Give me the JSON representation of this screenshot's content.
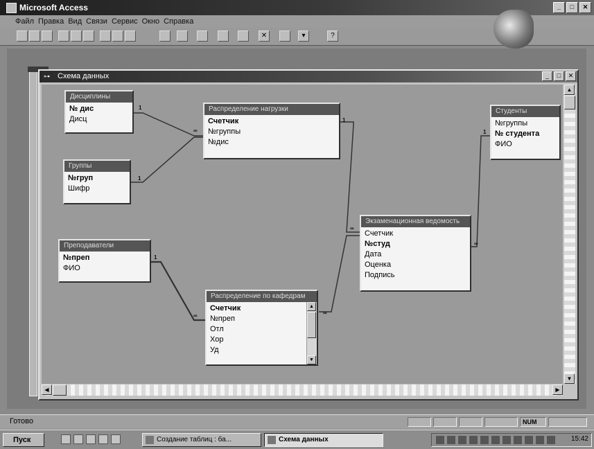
{
  "app": {
    "title": "Microsoft Access"
  },
  "menu": [
    "Файл",
    "Правка",
    "Вид",
    "Связи",
    "Сервис",
    "Окно",
    "Справка"
  ],
  "schema_window": {
    "title": "Схема данных"
  },
  "tables": [
    {
      "title": "Дисциплины",
      "fields": [
        {
          "name": "№ дис",
          "key": true
        },
        {
          "name": "Дисц",
          "key": false
        }
      ]
    },
    {
      "title": "Распределение нагрузки",
      "fields": [
        {
          "name": "Счетчик",
          "key": true
        },
        {
          "name": "№группы",
          "key": false
        },
        {
          "name": "№дис",
          "key": false
        }
      ]
    },
    {
      "title": "Студенты",
      "fields": [
        {
          "name": "№группы",
          "key": false
        },
        {
          "name": "№ студента",
          "key": true
        },
        {
          "name": "ФИО",
          "key": false
        }
      ]
    },
    {
      "title": "Группы",
      "fields": [
        {
          "name": "№груп",
          "key": true
        },
        {
          "name": "Шифр",
          "key": false
        }
      ]
    },
    {
      "title": "Преподаватели",
      "fields": [
        {
          "name": "№преп",
          "key": true
        },
        {
          "name": "ФИО",
          "key": false
        }
      ]
    },
    {
      "title": "Экзаменационная ведомость",
      "fields": [
        {
          "name": "Счетчик",
          "key": false
        },
        {
          "name": "№студ",
          "key": true
        },
        {
          "name": "Дата",
          "key": false
        },
        {
          "name": "Оценка",
          "key": false
        },
        {
          "name": "Подпись",
          "key": false
        }
      ]
    },
    {
      "title": "Распределение по кафедрам",
      "fields": [
        {
          "name": "Счетчик",
          "key": true
        },
        {
          "name": "№преп",
          "key": false
        },
        {
          "name": "Отл",
          "key": false
        },
        {
          "name": "Хор",
          "key": false
        },
        {
          "name": "Уд",
          "key": false
        }
      ]
    }
  ],
  "relations": [
    {
      "from": "Дисциплины",
      "to": "Распределение нагрузки",
      "one": "1",
      "many": "∞"
    },
    {
      "from": "Группы",
      "to": "Распределение нагрузки",
      "one": "1",
      "many": "∞"
    },
    {
      "from": "Распределение нагрузки",
      "to": "Экзаменационная ведомость",
      "one": "1",
      "many": "∞"
    },
    {
      "from": "Студенты",
      "to": "Экзаменационная ведомость",
      "one": "1",
      "many": "∞"
    },
    {
      "from": "Преподаватели",
      "to": "Распределение по кафедрам",
      "one": "1",
      "many": "∞"
    },
    {
      "from": "Экзаменационная ведомость",
      "to": "Распределение по кафедрам",
      "one": "1",
      "many": "∞"
    }
  ],
  "status": {
    "text": "Готово",
    "indicator": "NUM"
  },
  "taskbar": {
    "start": "Пуск",
    "tasks": [
      {
        "label": "Создание таблиц : ба...",
        "active": false
      },
      {
        "label": "Схема данных",
        "active": true
      }
    ],
    "clock": "15:42"
  }
}
